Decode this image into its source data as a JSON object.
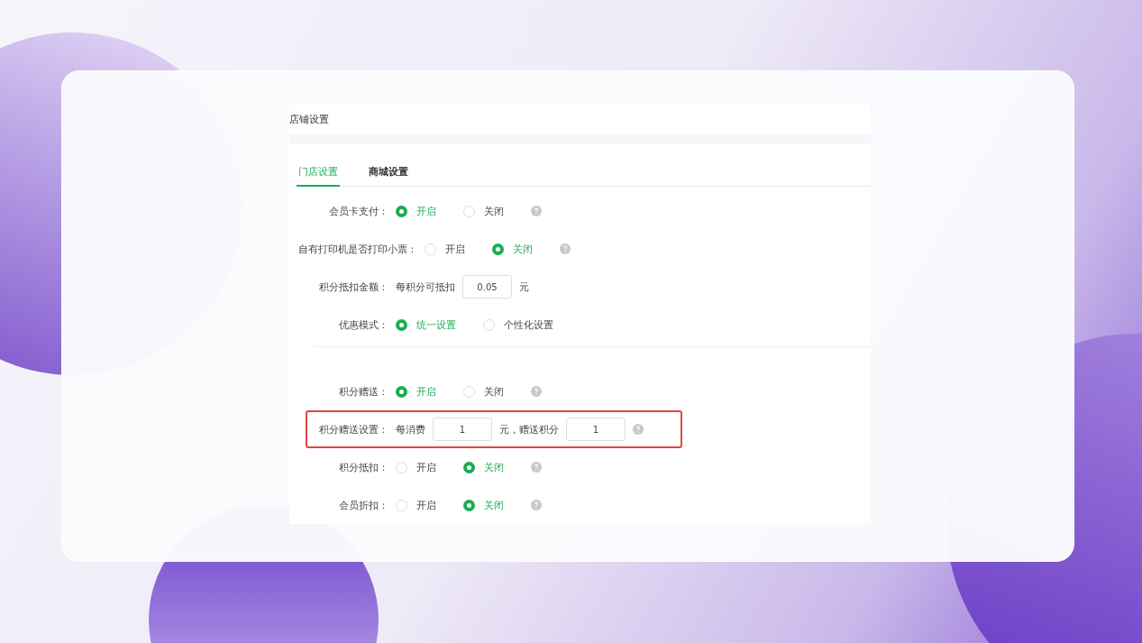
{
  "page_title": "店铺设置",
  "tabs": [
    {
      "label": "门店设置",
      "selected": true
    },
    {
      "label": "商城设置",
      "selected": false
    }
  ],
  "settings": [
    {
      "kind": "radio",
      "label": "会员卡支付：",
      "help": true,
      "divider_before": false,
      "highlighted": false,
      "options": [
        {
          "label": "开启",
          "selected": true
        },
        {
          "label": "关闭",
          "selected": false
        }
      ]
    },
    {
      "kind": "radio",
      "label": "自有打印机是否打印小票：",
      "help": true,
      "divider_before": false,
      "highlighted": false,
      "options": [
        {
          "label": "开启",
          "selected": false
        },
        {
          "label": "关闭",
          "selected": true
        }
      ]
    },
    {
      "kind": "inputs",
      "label": "积分抵扣金额：",
      "help": false,
      "divider_before": false,
      "highlighted": false,
      "parts": [
        {
          "kind": "text",
          "text": "每积分可抵扣"
        },
        {
          "kind": "input",
          "value": "0.05"
        },
        {
          "kind": "text",
          "text": "元"
        }
      ]
    },
    {
      "kind": "radio",
      "label": "优惠模式：",
      "help": false,
      "divider_before": false,
      "highlighted": false,
      "options": [
        {
          "label": "统一设置",
          "selected": true
        },
        {
          "label": "个性化设置",
          "selected": false
        }
      ]
    },
    {
      "kind": "radio",
      "label": "积分赠送：",
      "help": true,
      "divider_before": true,
      "highlighted": false,
      "options": [
        {
          "label": "开启",
          "selected": true
        },
        {
          "label": "关闭",
          "selected": false
        }
      ]
    },
    {
      "kind": "inputs",
      "label": "积分赠送设置：",
      "help": true,
      "divider_before": false,
      "highlighted": true,
      "parts": [
        {
          "kind": "text",
          "text": "每消费"
        },
        {
          "kind": "input",
          "value": "1"
        },
        {
          "kind": "text",
          "text": "元，赠送积分"
        },
        {
          "kind": "input",
          "value": "1"
        }
      ]
    },
    {
      "kind": "radio",
      "label": "积分抵扣：",
      "help": true,
      "divider_before": false,
      "highlighted": false,
      "options": [
        {
          "label": "开启",
          "selected": false
        },
        {
          "label": "关闭",
          "selected": true
        }
      ]
    },
    {
      "kind": "radio",
      "label": "会员折扣：",
      "help": true,
      "divider_before": false,
      "highlighted": false,
      "options": [
        {
          "label": "开启",
          "selected": false
        },
        {
          "label": "关闭",
          "selected": true
        }
      ]
    }
  ]
}
